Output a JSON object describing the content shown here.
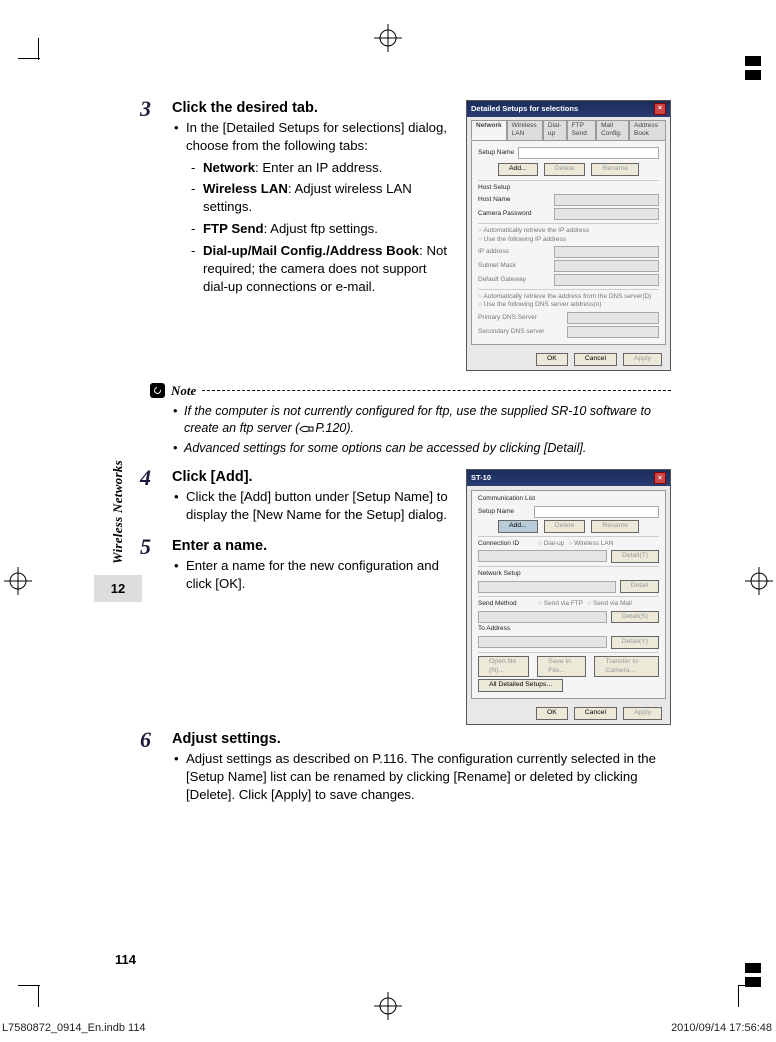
{
  "chapter": {
    "label": "Wireless Networks",
    "number": "12"
  },
  "page_number": "114",
  "footer": {
    "left": "L7580872_0914_En.indb   114",
    "right": "2010/09/14   17:56:48"
  },
  "step3": {
    "num": "3",
    "title": "Click the desired tab.",
    "bullet1_pre": "In the [Detailed Setups for selections] dialog, choose from the following tabs:",
    "net_label": "Network",
    "net_text": ": Enter an IP address.",
    "wlan_label": "Wireless LAN",
    "wlan_text": ": Adjust wireless LAN settings.",
    "ftp_label": "FTP Send",
    "ftp_text": ": Adjust ftp settings.",
    "dial_label": "Dial-up/Mail Config./Address Book",
    "dial_text": ": Not required; the camera does not support dial-up connections or e-mail."
  },
  "dlg1": {
    "title": "Detailed Setups for selections",
    "tabs": {
      "network": "Network",
      "wlan": "Wireless LAN",
      "dialup": "Dial-up",
      "ftp": "FTP Send",
      "mail": "Mail Config.",
      "addr": "Address Book"
    },
    "setupname": "Setup Name",
    "add": "Add...",
    "delete": "Delete",
    "rename": "Rename",
    "hostsetup": "Host Setup",
    "hostname": "Host Name",
    "campwd": "Camera Password",
    "r1": "Automatically retrieve the IP address",
    "r2": "Use the following IP address",
    "ip": "IP address",
    "mask": "Subnet Mask",
    "gw": "Default Gateway",
    "r3": "Automatically retrieve the address from the DNS server(D)",
    "r4": "Use the following DNS server address(o)",
    "dns1": "Primary DNS Server",
    "dns2": "Secondary DNS server",
    "ok": "OK",
    "cancel": "Cancel",
    "apply": "Apply"
  },
  "note": {
    "label": "Note",
    "item1a": "If the computer is not currently configured for ftp, use the supplied SR-10 software to create an ftp server (",
    "item1b": "P.120).",
    "item2": "Advanced settings for some options can be accessed by clicking [Detail]."
  },
  "step4": {
    "num": "4",
    "title": "Click [Add].",
    "b1": "Click the [Add] button under [Setup Name] to display the [New Name for the Setup] dialog."
  },
  "step5": {
    "num": "5",
    "title": "Enter a name.",
    "b1": "Enter a name for the new configuration and click [OK]."
  },
  "step6": {
    "num": "6",
    "title": "Adjust settings.",
    "b1": "Adjust settings as described on P.116. The configuration currently selected in the [Setup Name] list can be renamed by clicking [Rename] or deleted by clicking [Delete]. Click [Apply] to save changes."
  },
  "dlg2": {
    "title": "ST-10",
    "commlist": "Communication List",
    "setupname": "Setup Name",
    "add": "Add...",
    "delete": "Delete",
    "rename": "Rename",
    "connid": "Connection ID",
    "r_dial": "Dial-up",
    "r_wlan": "Wireless LAN",
    "detail": "Detail(T)",
    "netset": "Network Setup",
    "btn_d": "Detail",
    "sendm": "Send Method",
    "r_ftp": "Send via FTP",
    "r_mail": "Send via Mail",
    "btn_d2": "Detail(S)",
    "toaddr": "To Address",
    "btn_d3": "Detail(Y)",
    "open": "Open file (N)...",
    "save": "Save in File...",
    "transfer": "Transfer to Camera...",
    "alldet": "All Detailed Setups...",
    "ok": "OK",
    "cancel": "Cancel",
    "apply": "Apply"
  }
}
